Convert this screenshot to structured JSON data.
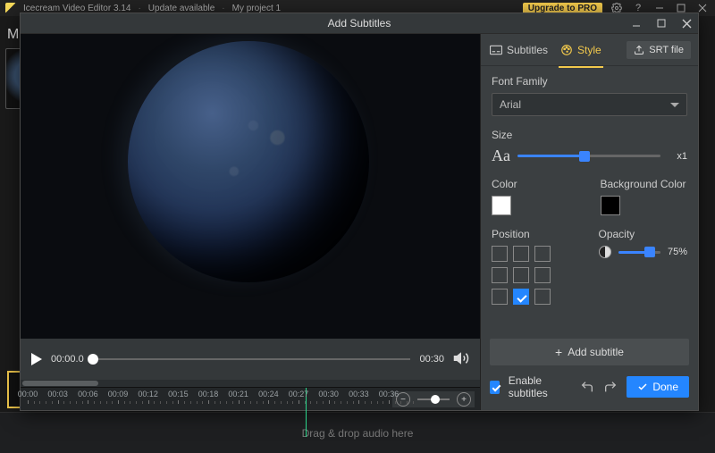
{
  "app": {
    "title": "Icecream Video Editor 3.14",
    "update_notice": "Update available",
    "project": "My project 1",
    "upgrade_label": "Upgrade to PRO"
  },
  "modal": {
    "title": "Add Subtitles"
  },
  "tabs": {
    "subtitles": "Subtitles",
    "style": "Style",
    "active": "style"
  },
  "srt_button": "SRT file",
  "style": {
    "font_family_label": "Font Family",
    "font_family_value": "Arial",
    "size_label": "Size",
    "size_value": "x1",
    "size_percent": 47,
    "color_label": "Color",
    "color_value": "#ffffff",
    "bg_color_label": "Background Color",
    "bg_color_value": "#000000",
    "position_label": "Position",
    "position_index": 7,
    "opacity_label": "Opacity",
    "opacity_value": "75%",
    "opacity_percent": 75
  },
  "actions": {
    "add_subtitle": "Add subtitle",
    "enable_subtitles": "Enable subtitles",
    "done": "Done"
  },
  "player": {
    "current_time": "00:00.0",
    "duration": "00:30",
    "progress_percent": 0
  },
  "timeline": {
    "marks": [
      "00:00",
      "00:03",
      "00:06",
      "00:09",
      "00:12",
      "00:15",
      "00:18",
      "00:21",
      "00:24",
      "00:27",
      "00:30",
      "00:33",
      "00:36"
    ],
    "playhead_percent": 77
  },
  "footer_hint": "Drag & drop audio here",
  "side_letter": "M"
}
